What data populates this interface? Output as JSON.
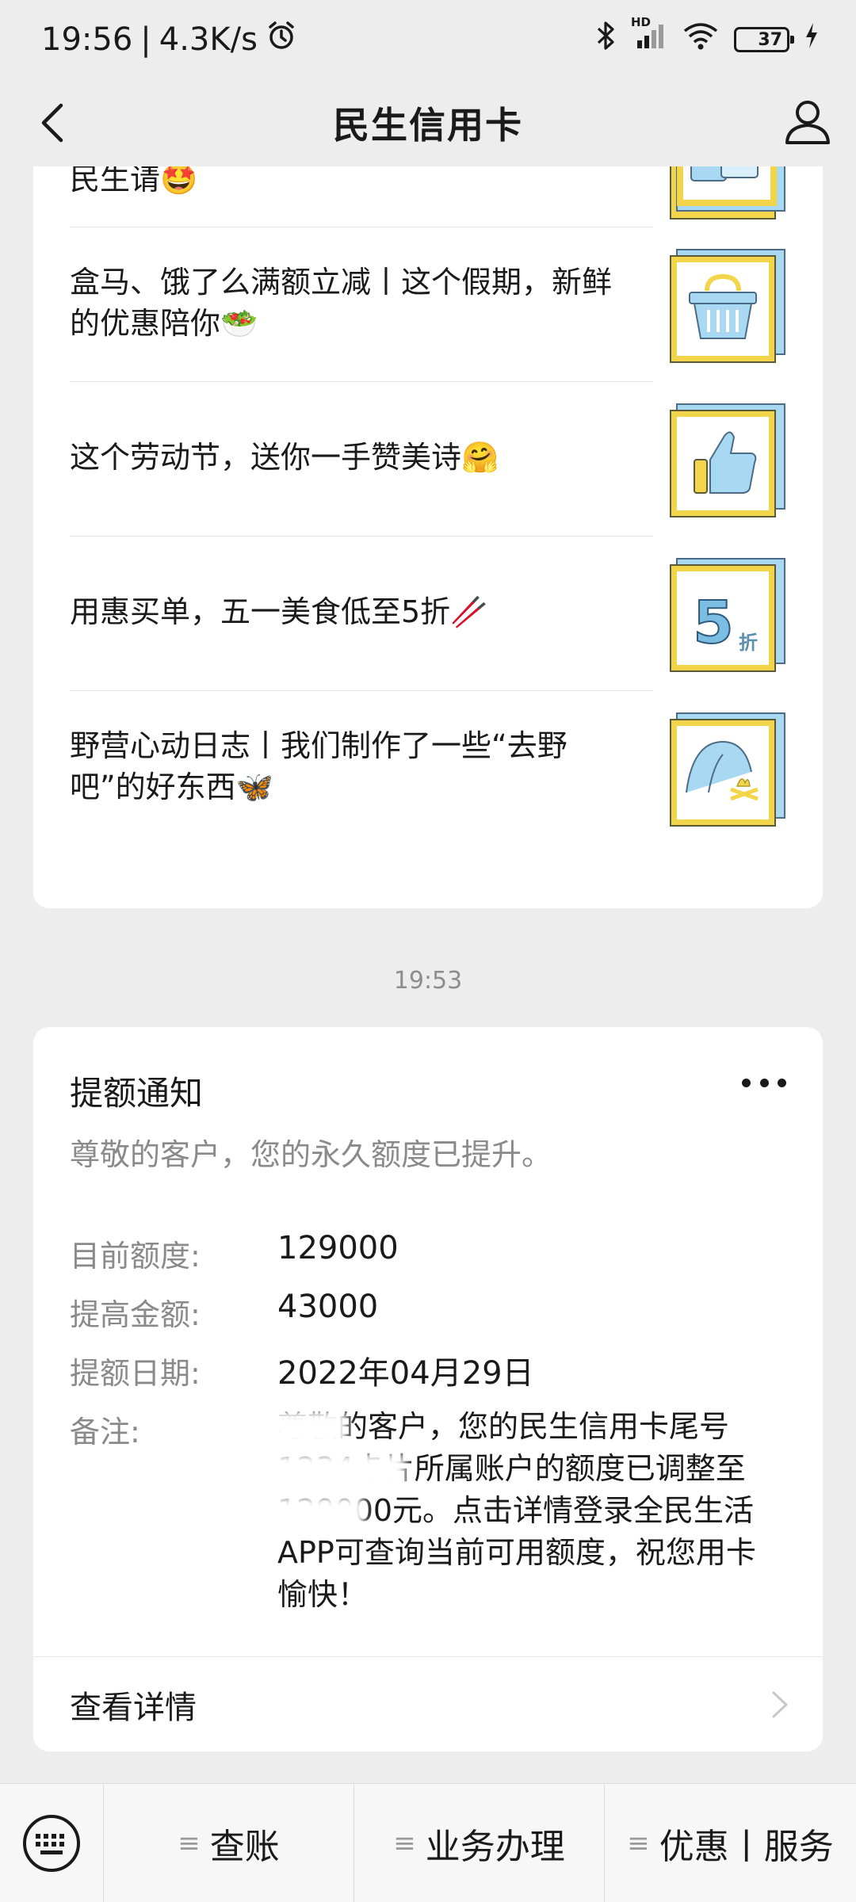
{
  "status_bar": {
    "time": "19:56",
    "separator": "|",
    "net_speed": "4.3K/s",
    "signal_label": "HD",
    "battery": "37",
    "battery_level": 0.37
  },
  "nav": {
    "title": "民生信用卡"
  },
  "articles": [
    {
      "text": "春日里的买一赠一快乐丨第二杯星巴克，民生请🤩",
      "thumb_icon": "coffee-cups-icon"
    },
    {
      "text": "盒马、饿了么满额立减丨这个假期，新鲜的优惠陪你🥗",
      "thumb_icon": "shopping-basket-icon"
    },
    {
      "text": "这个劳动节，送你一手赞美诗🤗",
      "thumb_icon": "thumbs-up-icon"
    },
    {
      "text": "用惠买单，五一美食低至5折🥢",
      "thumb_icon": "discount-five-icon",
      "thumb_label": "5",
      "thumb_sub": "折"
    },
    {
      "text": "野营心动日志丨我们制作了一些“去野吧”的好东西🦋",
      "thumb_icon": "tent-icon"
    }
  ],
  "timestamp": "19:53",
  "notice": {
    "title": "提额通知",
    "subtitle": "尊敬的客户，您的永久额度已提升。",
    "fields": [
      {
        "label": "目前额度:",
        "value": "129000"
      },
      {
        "label": "提高金额:",
        "value": "43000"
      },
      {
        "label": "提额日期:",
        "value": "2022年04月29日"
      }
    ],
    "remark_label": "备注:",
    "remark_text": "尊敬的客户，您的民生信用卡尾号1234卡片所属账户的额度已调整至129000元。点击详情登录全民生活APP可查询当前可用额度，祝您用卡愉快！",
    "detail_link": "查看详情"
  },
  "bottom_menu": {
    "items": [
      {
        "label": "查账"
      },
      {
        "label": "业务办理"
      },
      {
        "label": "优惠丨服务"
      }
    ]
  },
  "colors": {
    "background": "#ededed",
    "card": "#ffffff",
    "thumb_blue": "#a9d8f2",
    "thumb_yellow": "#f2d54b"
  }
}
